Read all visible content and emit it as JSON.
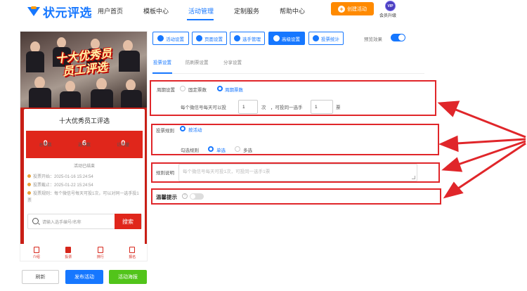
{
  "header": {
    "logo_text": "状元评选",
    "nav": [
      "用户首页",
      "模板中心",
      "活动管理",
      "定制服务",
      "帮助中心"
    ],
    "active_nav": "活动管理",
    "create_button": "创建活动",
    "vip_badge": "VIP",
    "vip_label": "会员升级"
  },
  "phone": {
    "banner_title_line1": "十大优秀员",
    "banner_title_line2": "员工评选",
    "activity_title": "十大优秀员工评选",
    "stats": [
      {
        "value": "0",
        "label": "总票数"
      },
      {
        "value": "6",
        "label": "选手数"
      },
      {
        "value": "0",
        "label": "访问量"
      }
    ],
    "status": "活动已结束",
    "info": [
      "投票开始：2025-01-16 15:24:54",
      "投票截止：2025-01-22 15:24:54",
      "投票规则：每个微信号每天可投1次，可以对同一选手投1票"
    ],
    "search_placeholder": "请输入选手编号/名称",
    "search_button": "搜索",
    "tabs": [
      {
        "label": "介绍",
        "icon": "intro-icon"
      },
      {
        "label": "投票",
        "icon": "vote-icon"
      },
      {
        "label": "排行",
        "icon": "ranking-icon"
      },
      {
        "label": "报名",
        "icon": "signup-icon"
      }
    ],
    "active_tab": "投票"
  },
  "phone_buttons": {
    "refresh": "刷新",
    "publish": "发布活动",
    "poster": "活动海报"
  },
  "toolbar": {
    "buttons": [
      {
        "label": "活动设置",
        "icon": "settings-icon"
      },
      {
        "label": "页面设置",
        "icon": "page-icon"
      },
      {
        "label": "选手管理",
        "icon": "users-icon"
      },
      {
        "label": "高级设置",
        "icon": "advanced-icon"
      },
      {
        "label": "投票统计",
        "icon": "chart-icon"
      }
    ],
    "active": "高级设置",
    "preview_label": "预览效果",
    "preview_on": true
  },
  "subtabs": {
    "items": [
      "投票设置",
      "防刷票设置",
      "分享设置"
    ],
    "active": "投票设置"
  },
  "vote_settings": {
    "cycle_label": "周期设置",
    "cycle_options": [
      "固定票数",
      "周期票数"
    ],
    "cycle_selected": "周期票数",
    "per_day_prefix": "每个微信号每天可以投",
    "per_day_value": "1",
    "per_day_unit": "次",
    "same_player_prefix": "，可投同一选手",
    "same_player_value": "1",
    "same_player_unit": "票",
    "rule_label": "投票规则",
    "rule_option": "按活动",
    "check_rule_label": "勾选规则",
    "check_options": [
      "单选",
      "多选"
    ],
    "check_selected": "单选",
    "desc_label": "规则说明",
    "desc_placeholder": "每个微信号每天可投1次，可投同一选手1票",
    "warm_tip_label": "温馨提示",
    "warm_tip_on": false
  },
  "colors": {
    "brand_blue": "#1677ff",
    "orange": "#ff8a00",
    "phone_red": "#e0261b",
    "annotation_red": "#e0262a",
    "green": "#52c41a"
  }
}
